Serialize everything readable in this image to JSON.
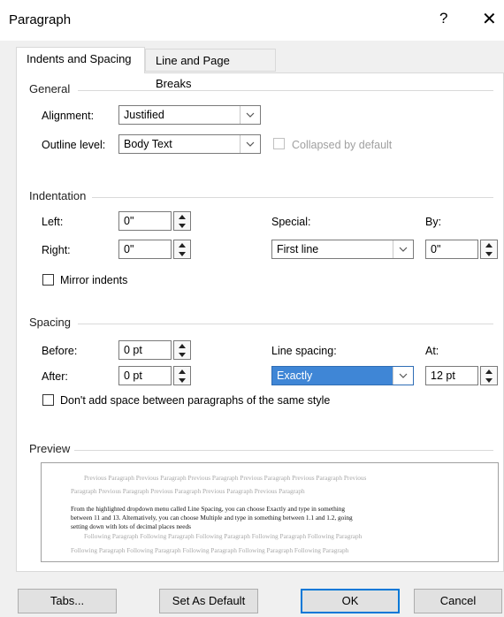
{
  "dialog": {
    "title": "Paragraph",
    "help_label": "?",
    "close_label": "✕"
  },
  "tabs": [
    {
      "label": "Indents and Spacing",
      "active": true
    },
    {
      "label": "Line and Page Breaks",
      "active": false
    }
  ],
  "general": {
    "heading": "General",
    "alignment_label": "Alignment:",
    "alignment_value": "Justified",
    "outline_label": "Outline level:",
    "outline_value": "Body Text",
    "collapsed_label": "Collapsed by default"
  },
  "indentation": {
    "heading": "Indentation",
    "left_label": "Left:",
    "left_value": "0\"",
    "right_label": "Right:",
    "right_value": "0\"",
    "special_label": "Special:",
    "special_value": "First line",
    "by_label": "By:",
    "by_value": "0\"",
    "mirror_label": "Mirror indents"
  },
  "spacing": {
    "heading": "Spacing",
    "before_label": "Before:",
    "before_value": "0 pt",
    "after_label": "After:",
    "after_value": "0 pt",
    "line_spacing_label": "Line spacing:",
    "line_spacing_value": "Exactly",
    "at_label": "At:",
    "at_value": "12 pt",
    "dont_add_label": "Don't add space between paragraphs of the same style"
  },
  "preview": {
    "heading": "Preview",
    "prev_line1": "Previous Paragraph Previous Paragraph Previous Paragraph Previous Paragraph Previous Paragraph Previous",
    "prev_line2": "Paragraph Previous Paragraph Previous Paragraph Previous Paragraph Previous Paragraph",
    "sample_line1": "From the highlighted dropdown menu called Line Spacing, you can choose Exactly and type in something",
    "sample_line2": "between 11 and 13. Alternatively, you can choose Multiple and type in something between 1.1 and 1.2, going",
    "sample_line3": "setting down with lots of decimal places needs",
    "follow_line1": "Following Paragraph Following Paragraph Following Paragraph Following Paragraph Following Paragraph",
    "follow_line2": "Following Paragraph Following Paragraph Following Paragraph Following Paragraph Following Paragraph"
  },
  "buttons": {
    "tabs": "Tabs...",
    "set_default": "Set As Default",
    "ok": "OK",
    "cancel": "Cancel"
  },
  "colors": {
    "selection": "#3f86d6",
    "dialog_bg": "#f0f0f0"
  }
}
